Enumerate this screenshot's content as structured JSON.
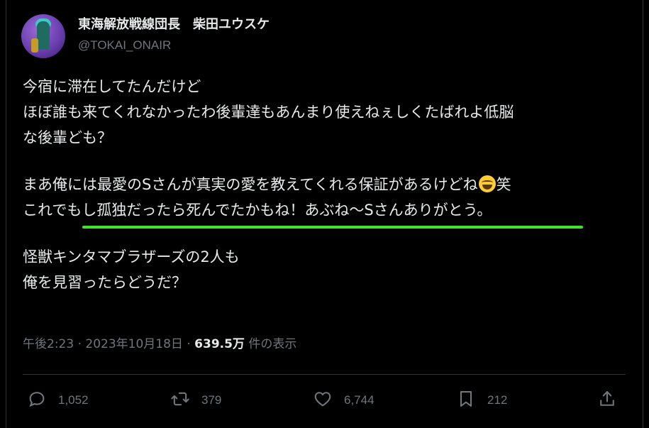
{
  "author": {
    "display_name": "東海解放戦線団長　柴田ユウスケ",
    "handle": "@TOKAI_ONAIR"
  },
  "tweet": {
    "lines": [
      "今宿に滞在してたんだけど",
      "ほぼ誰も来てくれなかったわ後輩達もあんまり使えねぇしくたばれよ低脳",
      "な後輩ども？",
      "",
      "まあ俺には最愛のSさんが真実の愛を教えてくれる保証があるけどね",
      "これでもし孤独だったら死んでたかもね！あぶね〜Sさんありがとう。",
      "",
      "怪獣キンタマブラザーズの2人も",
      "俺を見習ったらどうだ？"
    ],
    "line5_suffix": "笑",
    "emoji": "grinning-squinting-face-emoji"
  },
  "meta": {
    "time": "午後2:23",
    "date": "2023年10月18日",
    "views_count": "639.5万",
    "views_label": "件の表示",
    "separator": "·"
  },
  "actions": {
    "reply_count": "1,052",
    "retweet_count": "379",
    "like_count": "6,744",
    "bookmark_count": "212"
  },
  "colors": {
    "background": "#000000",
    "text": "#e7e9ea",
    "secondary": "#71767b",
    "highlight_underline": "#3fe22a"
  },
  "icons": [
    "reply-icon",
    "retweet-icon",
    "like-icon",
    "bookmark-icon",
    "share-icon"
  ]
}
